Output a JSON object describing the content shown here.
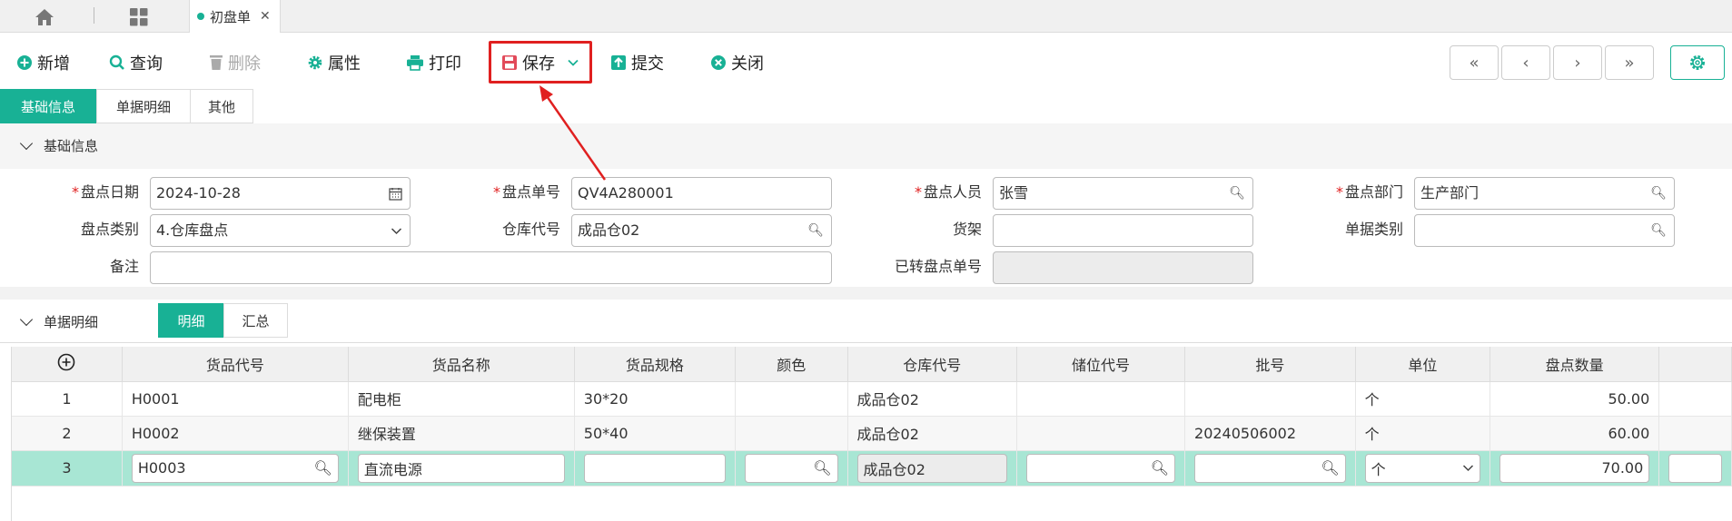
{
  "tabs": {
    "doc_tab_label": "初盘单"
  },
  "toolbar": {
    "add": "新增",
    "query": "查询",
    "delete": "删除",
    "props": "属性",
    "print": "打印",
    "save": "保存",
    "submit": "提交",
    "close": "关闭",
    "nav": [
      "«",
      "‹",
      "›",
      "»"
    ]
  },
  "subtabs": [
    "基础信息",
    "单据明细",
    "其他"
  ],
  "sections": {
    "basic": "基础信息",
    "detail": "单据明细"
  },
  "form": {
    "count_date_label": "盘点日期",
    "count_date": "2024-10-28",
    "count_no_label": "盘点单号",
    "count_no": "QV4A280001",
    "counter_label": "盘点人员",
    "counter": "张雪",
    "dept_label": "盘点部门",
    "dept": "生产部门",
    "count_type_label": "盘点类别",
    "count_type": "4.仓库盘点",
    "warehouse_label": "仓库代号",
    "warehouse": "成品仓02",
    "shelf_label": "货架",
    "shelf": "",
    "doc_type_label": "单据类别",
    "doc_type": "",
    "remark_label": "备注",
    "remark": "",
    "transferred_label": "已转盘点单号",
    "transferred": ""
  },
  "detail_tabs": [
    "明细",
    "汇总"
  ],
  "table": {
    "headers": [
      "货品代号",
      "货品名称",
      "货品规格",
      "颜色",
      "仓库代号",
      "储位代号",
      "批号",
      "单位",
      "盘点数量"
    ],
    "rows": [
      {
        "no": "1",
        "code": "H0001",
        "name": "配电柜",
        "spec": "30*20",
        "color": "",
        "wh": "成品仓02",
        "loc": "",
        "batch": "",
        "unit": "个",
        "qty": "50.00"
      },
      {
        "no": "2",
        "code": "H0002",
        "name": "继保装置",
        "spec": "50*40",
        "color": "",
        "wh": "成品仓02",
        "loc": "",
        "batch": "20240506002",
        "unit": "个",
        "qty": "60.00"
      },
      {
        "no": "3",
        "code": "H0003",
        "name": "直流电源",
        "spec": "",
        "color": "",
        "wh": "成品仓02",
        "loc": "",
        "batch": "",
        "unit": "个",
        "qty": "70.00"
      }
    ]
  },
  "colors": {
    "accent": "#18b195",
    "highlight": "#e02020",
    "selected_row": "#a8e6d4"
  }
}
